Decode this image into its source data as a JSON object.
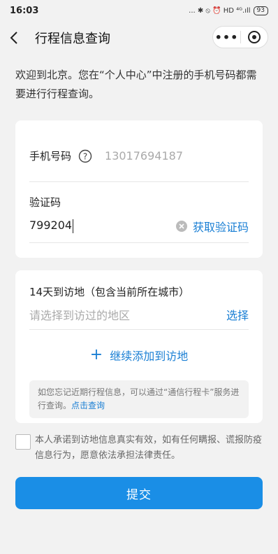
{
  "status": {
    "time": "16:03",
    "icons": "... ✱ ⦸ ⏰ HD ⁴ᴳ.ıll",
    "battery": "93"
  },
  "nav": {
    "title": "行程信息查询",
    "more": "•••"
  },
  "intro": "欢迎到北京。您在“个人中心”中注册的手机号码都需要进行行程查询。",
  "form": {
    "phone_label": "手机号码",
    "phone_value": "13017694187",
    "code_label": "验证码",
    "code_value": "799204",
    "get_code": "获取验证码"
  },
  "visit": {
    "title": "14天到访地（包含当前所在城市）",
    "placeholder": "请选择到访过的地区",
    "select": "选择",
    "add": "继续添加到访地",
    "tip": "如您忘记近期行程信息，可以通过“通信行程卡”服务进行查询。",
    "tip_link": "点击查询"
  },
  "agree": "本人承诺到访地信息真实有效，如有任何瞒报、谎报防疫信息行为，愿意依法承担法律责任。",
  "submit": "提交",
  "colors": {
    "accent": "#1a7fd4",
    "button": "#1a8ee6",
    "background": "#f2f2f2"
  }
}
